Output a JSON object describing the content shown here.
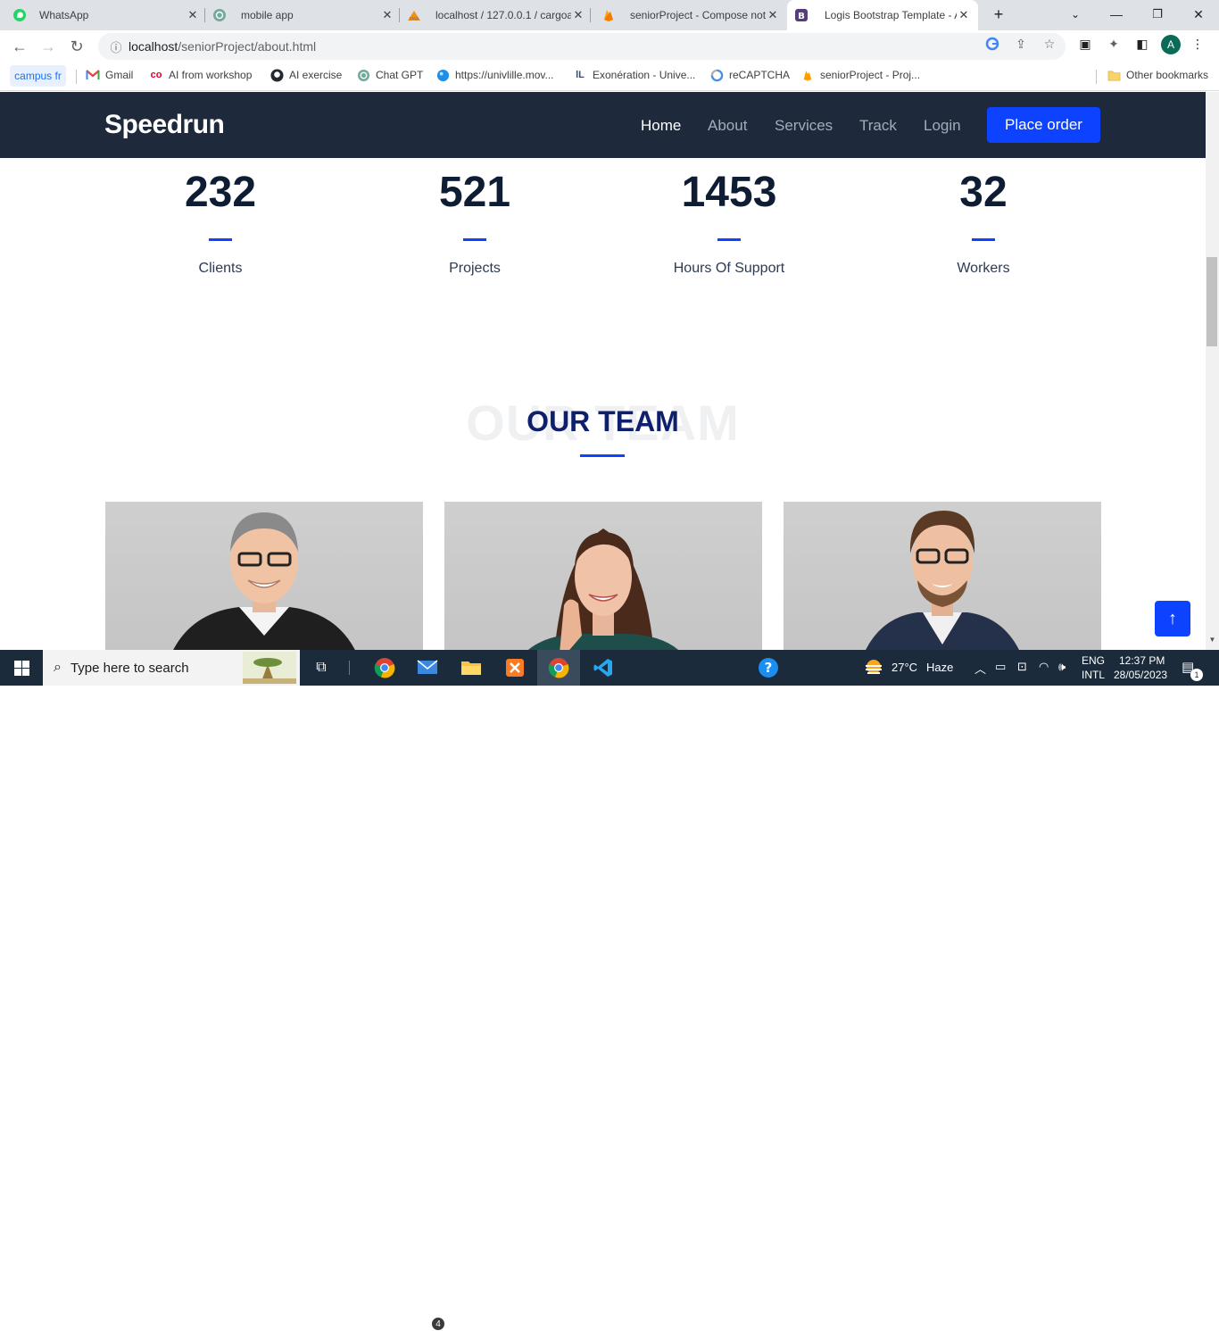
{
  "browser": {
    "tabs": [
      {
        "title": "WhatsApp",
        "icon": "whatsapp-icon"
      },
      {
        "title": "mobile app",
        "icon": "chatgpt-icon"
      },
      {
        "title": "localhost / 127.0.0.1 / cargoa",
        "icon": "phpmyadmin-icon"
      },
      {
        "title": "seniorProject - Compose not",
        "icon": "firebase-icon"
      },
      {
        "title": "Logis Bootstrap Template - A",
        "icon": "bootstrap-icon"
      }
    ],
    "url_host": "localhost",
    "url_path": "/seniorProject/about.html",
    "bookmarks": [
      {
        "label": "campus fr"
      },
      {
        "label": "Gmail"
      },
      {
        "label": "AI from workshop"
      },
      {
        "label": "AI exercise"
      },
      {
        "label": "Chat GPT"
      },
      {
        "label": "https://univlille.mov..."
      },
      {
        "label": "Exonération - Unive..."
      },
      {
        "label": "reCAPTCHA"
      },
      {
        "label": "seniorProject - Proj..."
      }
    ],
    "other_bookmarks": "Other bookmarks",
    "profile_initial": "A"
  },
  "site": {
    "brand": "Speedrun",
    "nav": {
      "home": "Home",
      "about": "About",
      "services": "Services",
      "track": "Track",
      "login": "Login"
    },
    "cta": "Place order",
    "stats": [
      {
        "value": "232",
        "label": "Clients"
      },
      {
        "value": "521",
        "label": "Projects"
      },
      {
        "value": "1453",
        "label": "Hours Of Support"
      },
      {
        "value": "32",
        "label": "Workers"
      }
    ],
    "team_title": "OUR TEAM",
    "team_ghost": "OUR TEAM"
  },
  "taskbar": {
    "search_placeholder": "Type here to search",
    "mail_badge": "4",
    "weather_temp": "27°C",
    "weather_desc": "Haze",
    "lang1": "ENG",
    "lang2": "INTL",
    "time": "12:37 PM",
    "date": "28/05/2023",
    "notif_count": "1"
  }
}
